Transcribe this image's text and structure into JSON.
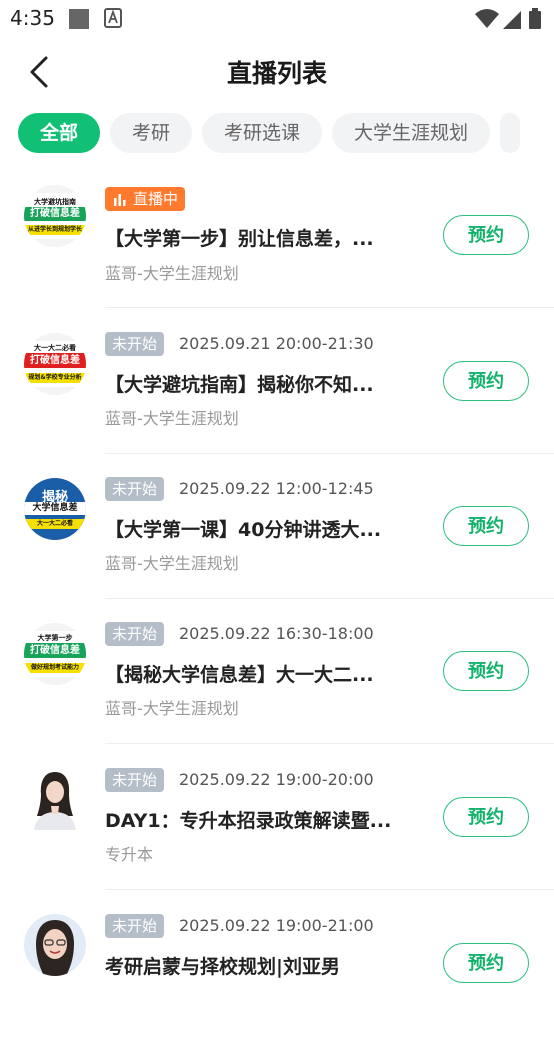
{
  "status_bar": {
    "time": "4:35"
  },
  "header": {
    "title": "直播列表"
  },
  "tabs": [
    {
      "label": "全部",
      "active": true
    },
    {
      "label": "考研",
      "active": false
    },
    {
      "label": "考研选课",
      "active": false
    },
    {
      "label": "大学生涯规划",
      "active": false
    }
  ],
  "items": [
    {
      "status": "直播中",
      "time": "",
      "title": "【大学第一步】别让信息差，...",
      "subtitle": "蓝哥-大学生涯规划",
      "button": "预约",
      "thumb_lines": [
        "大学避坑指南",
        "打破信息差",
        "从进学长到规划学长"
      ]
    },
    {
      "status": "未开始",
      "time": "2025.09.21 20:00-21:30",
      "title": "【大学避坑指南】揭秘你不知...",
      "subtitle": "蓝哥-大学生涯规划",
      "button": "预约",
      "thumb_lines": [
        "大一大二必看",
        "打破信息差",
        "规划&学校专业分析"
      ]
    },
    {
      "status": "未开始",
      "time": "2025.09.22 12:00-12:45",
      "title": "【大学第一课】40分钟讲透大...",
      "subtitle": "蓝哥-大学生涯规划",
      "button": "预约",
      "thumb_lines": [
        "揭秘",
        "大学信息差",
        "大一大二必看"
      ]
    },
    {
      "status": "未开始",
      "time": "2025.09.22 16:30-18:00",
      "title": "【揭秘大学信息差】大一大二...",
      "subtitle": "蓝哥-大学生涯规划",
      "button": "预约",
      "thumb_lines": [
        "大学第一步",
        "打破信息差",
        "做好规划考试能力"
      ]
    },
    {
      "status": "未开始",
      "time": "2025.09.22 19:00-20:00",
      "title": "DAY1：专升本招录政策解读暨...",
      "subtitle": "专升本",
      "button": "预约",
      "thumb_lines": []
    },
    {
      "status": "未开始",
      "time": "2025.09.22 19:00-21:00",
      "title": "考研启蒙与择校规划|刘亚男",
      "subtitle": "",
      "button": "预约",
      "thumb_lines": []
    }
  ]
}
